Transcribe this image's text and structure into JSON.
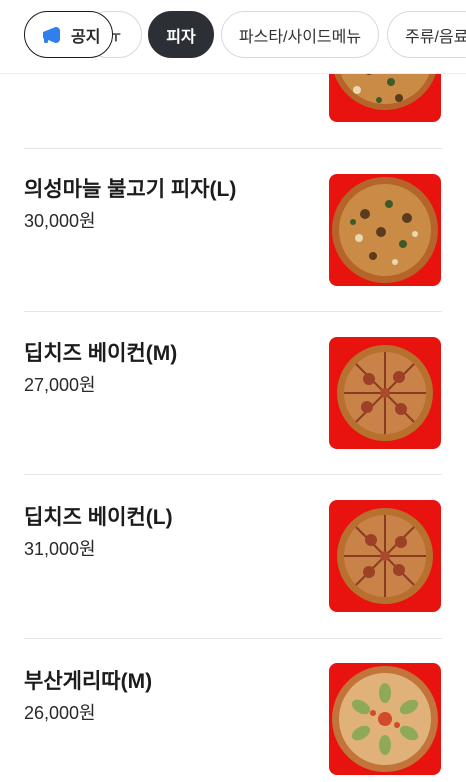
{
  "categories": {
    "notice_label": "공지",
    "partial_label": "ㅠ",
    "active_label": "피자",
    "pasta_label": "파스타/사이드메뉴",
    "drinks_label": "주류/음료"
  },
  "menu_items": [
    {
      "name": "의성마늘 불고기 피자(L)",
      "price": "30,000원",
      "icon": "pizza-bulgogi-icon"
    },
    {
      "name": "딥치즈 베이컨(M)",
      "price": "27,000원",
      "icon": "pizza-bacon-icon"
    },
    {
      "name": "딥치즈 베이컨(L)",
      "price": "31,000원",
      "icon": "pizza-bacon-icon"
    },
    {
      "name": "부산게리따(M)",
      "price": "26,000원",
      "icon": "pizza-crab-icon"
    }
  ],
  "colors": {
    "thumb_bg": "#e8130f",
    "active_chip": "#2c2f35",
    "notice_icon": "#2f80ed"
  }
}
